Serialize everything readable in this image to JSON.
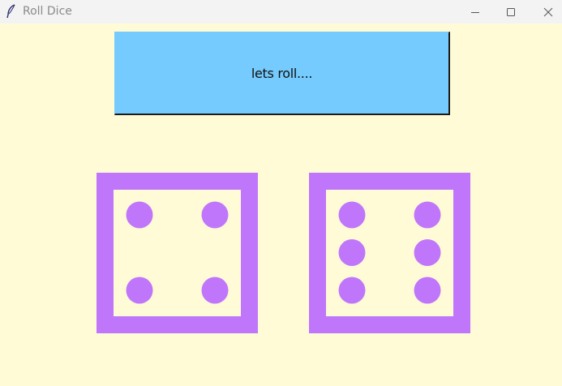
{
  "window": {
    "title": "Roll Dice"
  },
  "titlebar_buttons": {
    "minimize_icon": "minimize-icon",
    "maximize_icon": "maximize-icon",
    "close_icon": "close-icon"
  },
  "roll_button": {
    "label": "lets roll...."
  },
  "dice": [
    {
      "value": 4
    },
    {
      "value": 6
    }
  ],
  "colors": {
    "background": "#fffbd6",
    "button": "#75cbfd",
    "die": "#c076fa"
  }
}
